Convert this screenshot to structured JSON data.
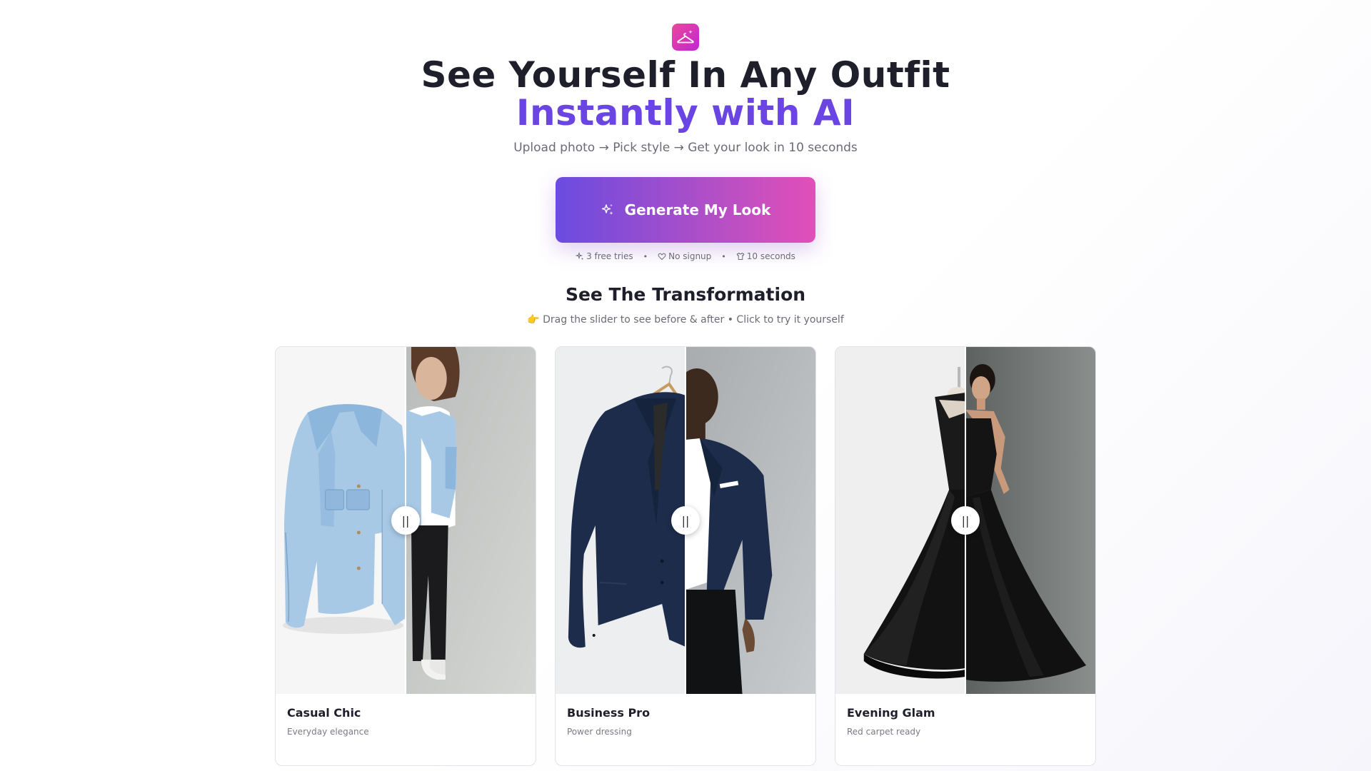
{
  "hero": {
    "headline": "See Yourself In Any Outfit",
    "headline_accent": "Instantly with AI",
    "tagline": "Upload photo → Pick style → Get your look in 10 seconds",
    "cta_label": "Generate My Look",
    "perks": [
      "3 free tries",
      "No signup",
      "10 seconds"
    ],
    "perk_separator": "•"
  },
  "section": {
    "title": "See The Transformation",
    "subtitle": "👉 Drag the slider to see before & after • Click to try it yourself"
  },
  "cards": [
    {
      "title": "Casual Chic",
      "subtitle": "Everyday elegance",
      "slider_position": 0.5,
      "handle_glyph": "||"
    },
    {
      "title": "Business Pro",
      "subtitle": "Power dressing",
      "slider_position": 0.5,
      "handle_glyph": "||"
    },
    {
      "title": "Evening Glam",
      "subtitle": "Red carpet ready",
      "slider_position": 0.5,
      "handle_glyph": "||"
    }
  ],
  "icons": {
    "logo": "hanger-sparkle-icon",
    "cta": "sparkles-icon",
    "perk_icons": [
      "sparkles-icon",
      "heart-icon",
      "shirt-icon"
    ]
  },
  "colors": {
    "accent": "#6a45e3",
    "brand_pink": "#e24fb8",
    "cta_start": "#6a4be0",
    "cta_end": "#e24fb8",
    "text": "#1f1f2b",
    "muted": "#6b6b78"
  }
}
